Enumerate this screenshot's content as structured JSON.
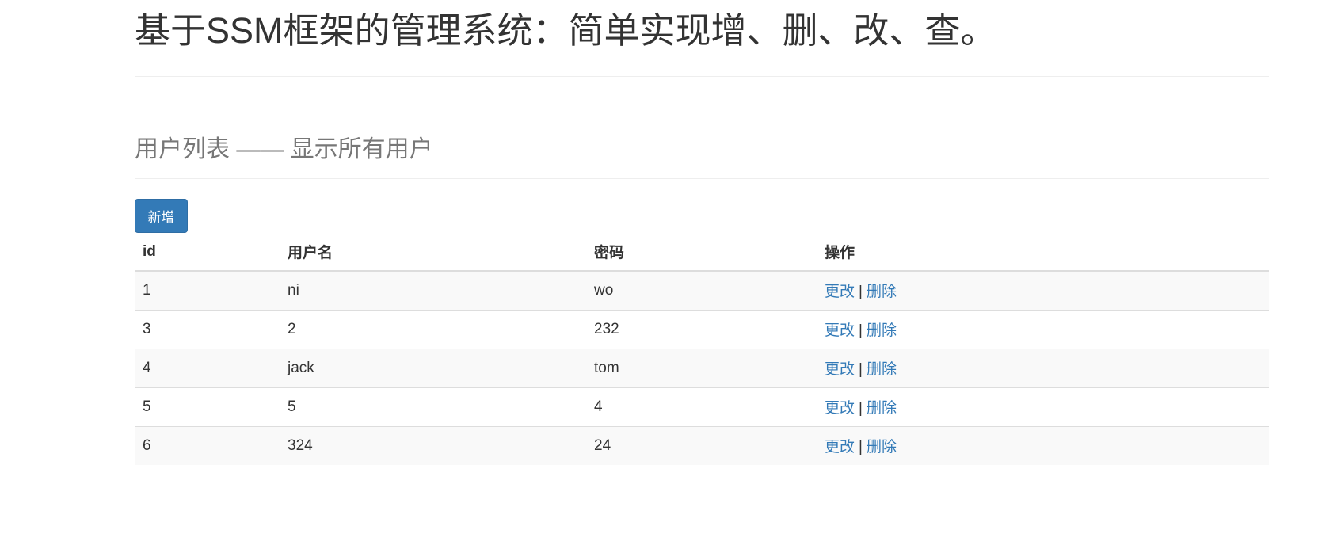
{
  "header": {
    "title": "基于SSM框架的管理系统：简单实现增、删、改、查。"
  },
  "section": {
    "subtitle": "用户列表 —— 显示所有用户"
  },
  "toolbar": {
    "add_label": "新增"
  },
  "table": {
    "columns": [
      "id",
      "用户名",
      "密码",
      "操作"
    ],
    "rows": [
      {
        "id": "1",
        "username": "ni",
        "password": "wo",
        "edit": "更改",
        "sep": "|",
        "delete": "删除"
      },
      {
        "id": "3",
        "username": "2",
        "password": "232",
        "edit": "更改",
        "sep": "|",
        "delete": "删除"
      },
      {
        "id": "4",
        "username": "jack",
        "password": "tom",
        "edit": "更改",
        "sep": "|",
        "delete": "删除"
      },
      {
        "id": "5",
        "username": "5",
        "password": "4",
        "edit": "更改",
        "sep": "|",
        "delete": "删除"
      },
      {
        "id": "6",
        "username": "324",
        "password": "24",
        "edit": "更改",
        "sep": "|",
        "delete": "删除"
      }
    ]
  },
  "colors": {
    "primary": "#337ab7",
    "text": "#333333",
    "muted": "#777777",
    "stripe": "#f9f9f9",
    "border": "#dddddd"
  }
}
